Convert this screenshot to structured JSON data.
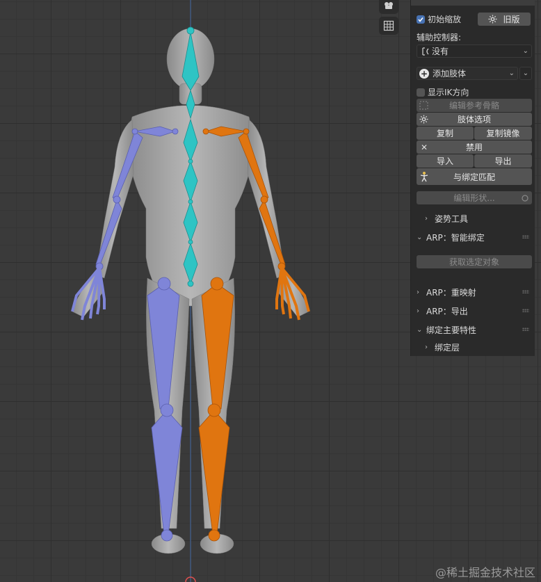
{
  "panel": {
    "initial_zoom": {
      "label": "初始缩放",
      "checked": true
    },
    "legacy_button": "旧版",
    "aux_controller_label": "辅助控制器:",
    "aux_controller_value": "没有",
    "add_limb": "添加肢体",
    "show_ik_dir": {
      "label": "显示IK方向",
      "checked": false
    },
    "edit_ref_bones": "编辑参考骨骼",
    "limb_options": "肢体选项",
    "duplicate": "复制",
    "duplicate_mirror": "复制镜像",
    "disable": "禁用",
    "import": "导入",
    "export": "导出",
    "match_to_rig": "与绑定匹配",
    "edit_shape": "编辑形状...",
    "pose_tools": "姿势工具",
    "arp_smart": "ARP：智能绑定",
    "get_selected": "获取选定对象",
    "arp_remap": "ARP：重映射",
    "arp_export": "ARP：导出",
    "rig_main_props": "绑定主要特性",
    "rig_layers": "绑定层"
  },
  "watermark": "@稀土掘金技术社区",
  "colors": {
    "spine": "#2ec4c4",
    "left_limbs": "#7f85d8",
    "right_limbs": "#e07510",
    "body": "#9e9e9e",
    "accent": "#4772b3"
  }
}
